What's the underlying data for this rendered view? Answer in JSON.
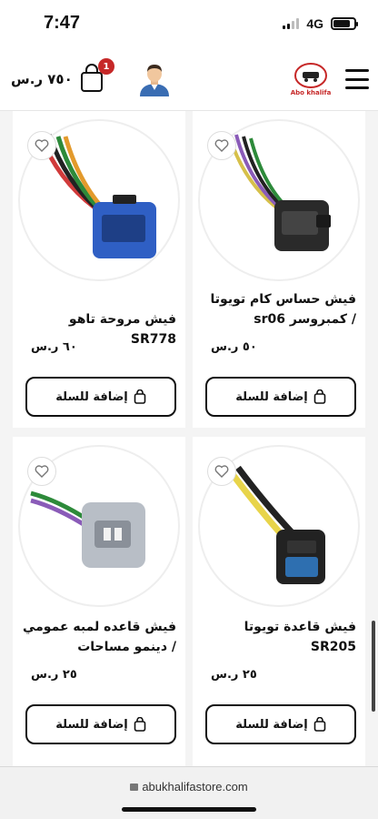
{
  "status_bar": {
    "time": "7:47",
    "network": "4G"
  },
  "header": {
    "cart_total": "٧٥٠ ر.س",
    "cart_count": "1",
    "logo_text": "Abo khalifa"
  },
  "products": [
    {
      "name": "فيش حساس كام تويوتا / كمبروسر sr06",
      "price": "٥٠ ر.س",
      "add_label": "إضافة للسلة"
    },
    {
      "name": "فيش مروحة تاهو SR778",
      "price": "٦٠ ر.س",
      "add_label": "إضافة للسلة"
    },
    {
      "name": "فيش قاعدة تويوتا SR205",
      "price": "٢٥ ر.س",
      "add_label": "إضافة للسلة"
    },
    {
      "name": "فيش قاعده لمبه عمومي / دينمو مساحات",
      "price": "٢٥ ر.س",
      "add_label": "إضافة للسلة"
    }
  ],
  "browser": {
    "url": "abukhalifastore.com"
  },
  "icons": {
    "menu": "hamburger-icon",
    "cart": "shopping-bag-icon",
    "profile": "user-avatar-icon",
    "wishlist": "heart-icon",
    "lock": "lock-icon"
  },
  "colors": {
    "accent": "#c62828",
    "connector_blue": "#2f5fc4",
    "connector_black": "#222222",
    "connector_grey": "#b8bec6"
  }
}
